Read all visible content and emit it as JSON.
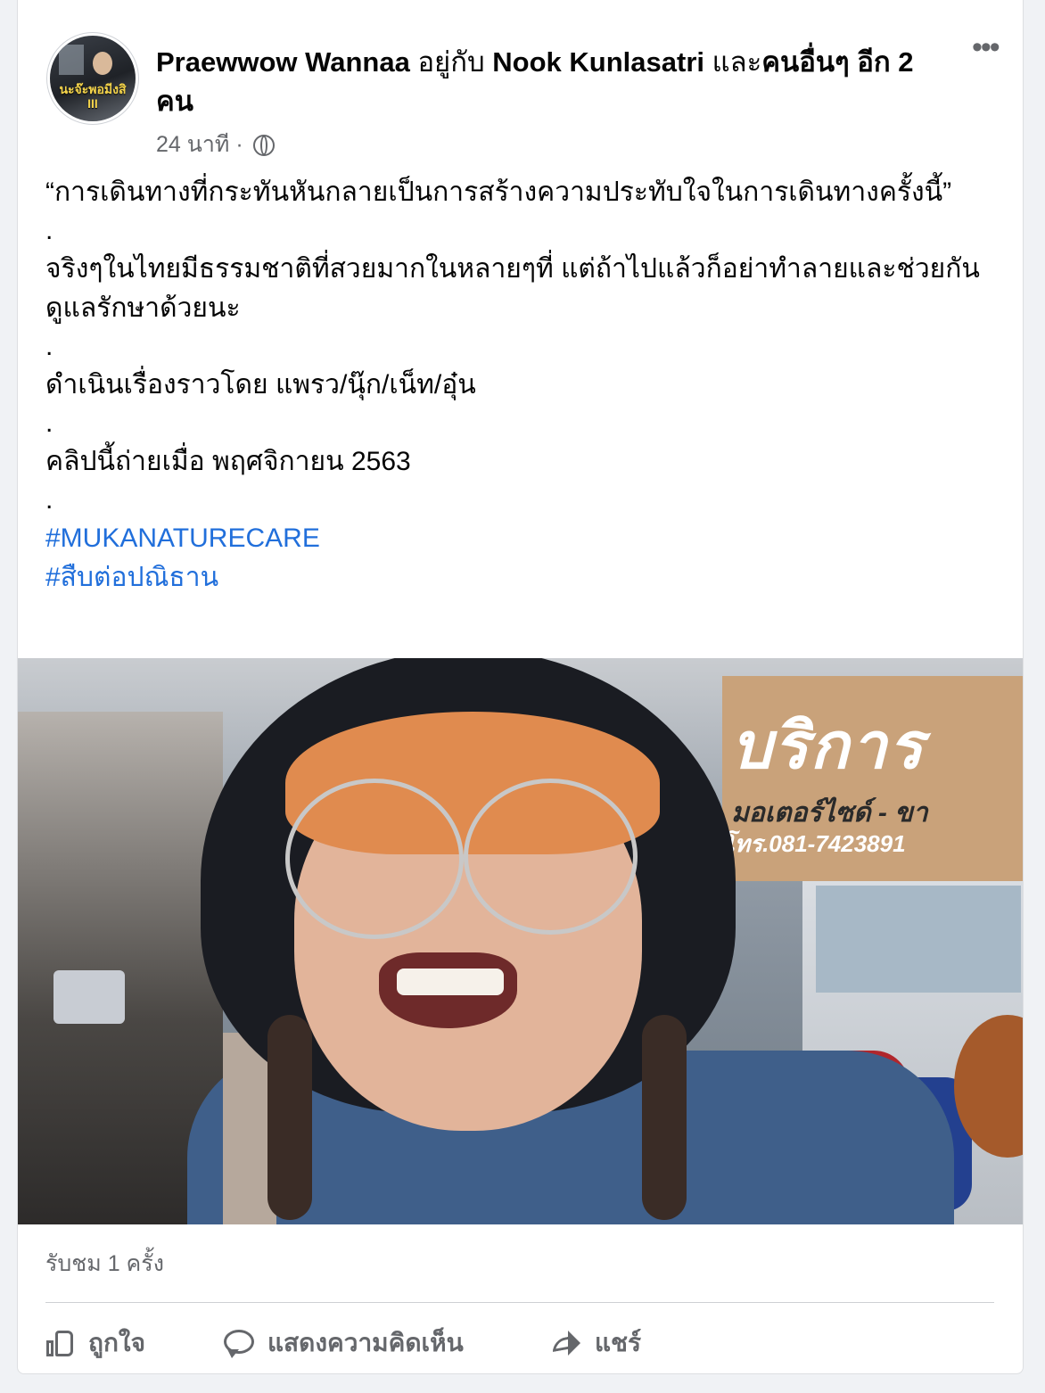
{
  "post": {
    "author": "Praewwow Wannaa",
    "with_word": "อยู่กับ",
    "tagged": "Nook Kunlasatri",
    "and_word": "และ",
    "others_link": "คนอื่นๆ อีก 2 คน",
    "avatar_text": "นะจ๊ะพอมีงสิ",
    "avatar_sub": "III",
    "time": "24 นาที",
    "separator": "·",
    "audience_icon": "globe-icon",
    "more_icon": "•••",
    "text": {
      "line1": "“การเดินทางที่กระทันหันกลายเป็นการสร้างความประทับใจในการเดินทางครั้งนี้”",
      "dot": ".",
      "line2": "จริงๆในไทยมีธรรมชาติที่สวยมากในหลายๆที่ แต่ถ้าไปแล้วก็อย่าทำลายและช่วยกันดูแลรักษาด้วยนะ",
      "line3": "ดำเนินเรื่องราวโดย แพรว/นุ๊ก/เน็ท/อุ๋น",
      "line4": "คลิปนี้ถ่ายเมื่อ พฤศจิกายน 2563",
      "hashtag1": "#MUKANATURECARE",
      "hashtag2": "#สืบต่อปณิธาน"
    },
    "video": {
      "sign_text": "บริการ",
      "sign_sub": "มอเตอร์ไซด์ - ขา",
      "sign_tel": "โทร.081-7423891"
    },
    "views": "รับชม 1 ครั้ง",
    "actions": {
      "like": "ถูกใจ",
      "comment": "แสดงความคิดเห็น",
      "share": "แชร์"
    }
  },
  "colors": {
    "link": "#216fdb",
    "secondary_text": "#65676b",
    "background": "#f0f2f5"
  }
}
